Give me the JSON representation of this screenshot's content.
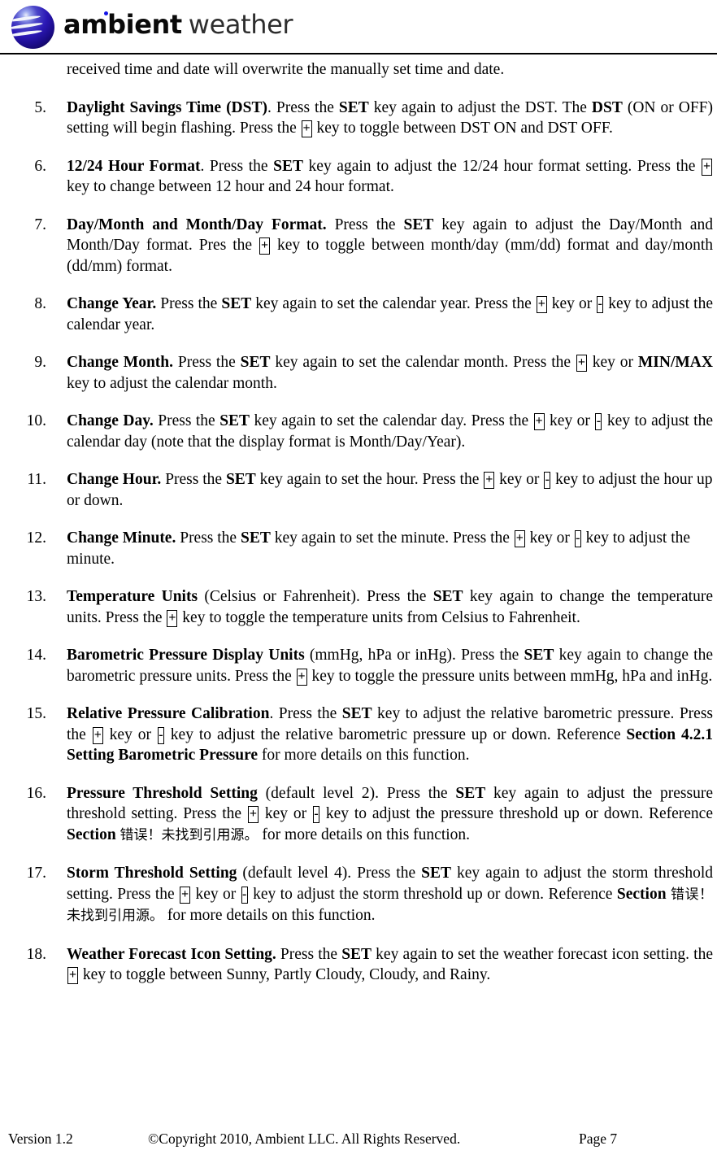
{
  "header": {
    "logo_word_bold": "ambient",
    "logo_word_light": "weather",
    "logo_icon": "ambient-weather-sphere-logo"
  },
  "document": {
    "lead_in": "received time and date will overwrite the manually set time and date.",
    "steps": [
      {
        "number": "5.",
        "title": "Daylight Savings Time (DST)",
        "body_parts": [
          {
            "type": "text",
            "text": ". Press the "
          },
          {
            "type": "bold",
            "text": "SET"
          },
          {
            "type": "text",
            "text": " key again to adjust the DST.    The "
          },
          {
            "type": "bold",
            "text": "DST"
          },
          {
            "type": "text",
            "text": " (ON or OFF) setting will begin flashing. Press the "
          },
          {
            "type": "key",
            "text": "+"
          },
          {
            "type": "text",
            "text": " key to toggle between DST ON and DST OFF."
          }
        ],
        "justified": true
      },
      {
        "number": "6.",
        "title": "12/24 Hour Format",
        "body_parts": [
          {
            "type": "text",
            "text": ". Press the "
          },
          {
            "type": "bold",
            "text": "SET"
          },
          {
            "type": "text",
            "text": " key again to adjust the 12/24 hour format setting. Press the "
          },
          {
            "type": "key",
            "text": "+"
          },
          {
            "type": "text",
            "text": " key to change between 12 hour and 24 hour format."
          }
        ],
        "justified": true
      },
      {
        "number": "7.",
        "title": "Day/Month and Month/Day Format.",
        "body_parts": [
          {
            "type": "text",
            "text": "   Press the "
          },
          {
            "type": "bold",
            "text": "SET"
          },
          {
            "type": "text",
            "text": " key again to adjust the Day/Month and Month/Day format. Pres the "
          },
          {
            "type": "key",
            "text": "+"
          },
          {
            "type": "text",
            "text": " key to toggle between month/day (mm/dd) format and day/month (dd/mm) format."
          }
        ],
        "justified": true
      },
      {
        "number": "8.",
        "title": "Change Year.",
        "body_parts": [
          {
            "type": "text",
            "text": " Press the "
          },
          {
            "type": "bold",
            "text": "SET"
          },
          {
            "type": "text",
            "text": " key again to set the calendar year. Press the "
          },
          {
            "type": "key",
            "text": "+"
          },
          {
            "type": "text",
            "text": " key or "
          },
          {
            "type": "key",
            "text": "-"
          },
          {
            "type": "text",
            "text": " key to adjust the calendar year."
          }
        ],
        "justified": true
      },
      {
        "number": "9.",
        "title": "Change Month.",
        "body_parts": [
          {
            "type": "text",
            "text": " Press the "
          },
          {
            "type": "bold",
            "text": "SET"
          },
          {
            "type": "text",
            "text": " key again to set the calendar month. Press the "
          },
          {
            "type": "key",
            "text": "+"
          },
          {
            "type": "text",
            "text": " key or "
          },
          {
            "type": "bold",
            "text": "MIN/MAX"
          },
          {
            "type": "text",
            "text": " key to adjust the calendar month."
          }
        ],
        "justified": true
      },
      {
        "number": "10.",
        "title": "Change Day.",
        "body_parts": [
          {
            "type": "text",
            "text": " Press the "
          },
          {
            "type": "bold",
            "text": "SET"
          },
          {
            "type": "text",
            "text": " key again to set the calendar day. Press the "
          },
          {
            "type": "key",
            "text": "+"
          },
          {
            "type": "text",
            "text": " key or "
          },
          {
            "type": "key",
            "text": "-"
          },
          {
            "type": "text",
            "text": " key to adjust the calendar day (note that the display format is Month/Day/Year)."
          }
        ],
        "justified": true
      },
      {
        "number": "11.",
        "title": "Change Hour.",
        "body_parts": [
          {
            "type": "text",
            "text": " Press the "
          },
          {
            "type": "bold",
            "text": "SET"
          },
          {
            "type": "text",
            "text": " key again to set the hour. Press the "
          },
          {
            "type": "key",
            "text": "+"
          },
          {
            "type": "text",
            "text": " key or "
          },
          {
            "type": "key",
            "text": "-"
          },
          {
            "type": "text",
            "text": " key to adjust the hour up or down."
          }
        ],
        "justified": false
      },
      {
        "number": "12.",
        "title": "Change Minute.",
        "body_parts": [
          {
            "type": "text",
            "text": " Press the "
          },
          {
            "type": "bold",
            "text": "SET"
          },
          {
            "type": "text",
            "text": " key again to set the minute. Press the "
          },
          {
            "type": "key",
            "text": "+"
          },
          {
            "type": "text",
            "text": " key or "
          },
          {
            "type": "key",
            "text": "-"
          },
          {
            "type": "text",
            "text": " key to adjust the minute."
          }
        ],
        "justified": false
      },
      {
        "number": "13.",
        "title": "Temperature  Units",
        "body_parts": [
          {
            "type": "text",
            "text": " (Celsius or Fahrenheit). Press the "
          },
          {
            "type": "bold",
            "text": "SET"
          },
          {
            "type": "text",
            "text": " key again to change the temperature units.  Press the "
          },
          {
            "type": "key",
            "text": "+"
          },
          {
            "type": "text",
            "text": " key to toggle the temperature units from Celsius to Fahrenheit."
          }
        ],
        "justified": true
      },
      {
        "number": "14.",
        "title": "Barometric Pressure Display Units",
        "body_parts": [
          {
            "type": "text",
            "text": " (mmHg, hPa or inHg). Press the "
          },
          {
            "type": "bold",
            "text": "SET"
          },
          {
            "type": "text",
            "text": " key again to change the barometric pressure units. Press the "
          },
          {
            "type": "key",
            "text": "+"
          },
          {
            "type": "text",
            "text": " key to toggle the pressure units between mmHg, hPa and inHg."
          }
        ],
        "justified": true
      },
      {
        "number": "15.",
        "title": "Relative Pressure Calibration",
        "body_parts": [
          {
            "type": "text",
            "text": ". Press the "
          },
          {
            "type": "bold",
            "text": "SET"
          },
          {
            "type": "text",
            "text": " key to adjust the relative barometric pressure. Press the "
          },
          {
            "type": "key",
            "text": "+"
          },
          {
            "type": "text",
            "text": " key or "
          },
          {
            "type": "key",
            "text": "-"
          },
          {
            "type": "text",
            "text": " key to adjust the relative barometric pressure up or down. Reference "
          },
          {
            "type": "bold",
            "text": "Section 4.2.1 Setting Barometric Pressure"
          },
          {
            "type": "text",
            "text": " for more details on this function."
          }
        ],
        "justified": true
      },
      {
        "number": "16.",
        "title": "Pressure  Threshold  Setting",
        "body_parts": [
          {
            "type": "text",
            "text": " (default level 2).  Press the "
          },
          {
            "type": "bold",
            "text": "SET"
          },
          {
            "type": "text",
            "text": " key again to adjust the pressure threshold setting.   Press the "
          },
          {
            "type": "key",
            "text": "+"
          },
          {
            "type": "text",
            "text": " key or "
          },
          {
            "type": "key",
            "text": "-"
          },
          {
            "type": "text",
            "text": " key to adjust the pressure threshold up or down. Reference "
          },
          {
            "type": "bold",
            "text": "Section"
          },
          {
            "type": "text",
            "text": " "
          },
          {
            "type": "cjk",
            "text": "错误！未找到引用源。"
          },
          {
            "type": "text",
            "text": "  for more details on this function."
          }
        ],
        "justified": true
      },
      {
        "number": "17.",
        "title": "Storm Threshold Setting",
        "body_parts": [
          {
            "type": "text",
            "text": " (default level 4).   Press the "
          },
          {
            "type": "bold",
            "text": "SET"
          },
          {
            "type": "text",
            "text": " key again to adjust the storm threshold setting.   Press the "
          },
          {
            "type": "key",
            "text": "+"
          },
          {
            "type": "text",
            "text": " key or "
          },
          {
            "type": "key",
            "text": "-"
          },
          {
            "type": "text",
            "text": " key to adjust the storm threshold up or down. Reference "
          },
          {
            "type": "bold",
            "text": "Section"
          },
          {
            "type": "text",
            "text": " "
          },
          {
            "type": "cjk",
            "text": "错误！未找到引用源。"
          },
          {
            "type": "text",
            "text": "  for more details on this function."
          }
        ],
        "justified": true
      },
      {
        "number": "18.",
        "title": "Weather Forecast Icon Setting.",
        "body_parts": [
          {
            "type": "text",
            "text": " Press the "
          },
          {
            "type": "bold",
            "text": "SET"
          },
          {
            "type": "text",
            "text": " key again to set the weather forecast icon setting. the "
          },
          {
            "type": "key",
            "text": "+"
          },
          {
            "type": "text",
            "text": " key to toggle between Sunny, Partly Cloudy, Cloudy, and Rainy."
          }
        ],
        "justified": true
      }
    ]
  },
  "footer": {
    "version": "Version 1.2",
    "copyright": "©Copyright 2010, Ambient LLC. All Rights Reserved.",
    "page": "Page 7"
  }
}
